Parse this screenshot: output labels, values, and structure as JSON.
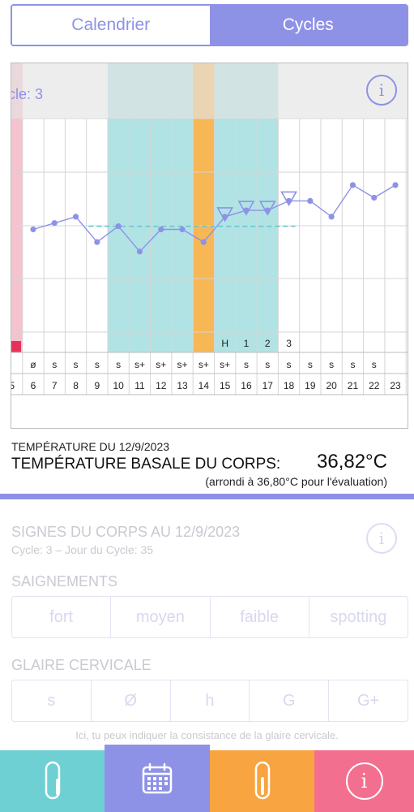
{
  "tabs": {
    "calendar": "Calendrier",
    "cycles": "Cycles"
  },
  "chart": {
    "cycle_label": "cle: 3",
    "info_glyph": "i",
    "day_numbers": [
      "5",
      "6",
      "7",
      "8",
      "9",
      "10",
      "11",
      "12",
      "13",
      "14",
      "15",
      "16",
      "17",
      "18",
      "19",
      "20",
      "21",
      "22",
      "23"
    ],
    "mucus_codes": [
      "",
      "ø",
      "s",
      "s",
      "s",
      "s",
      "s+",
      "s+",
      "s+",
      "s+",
      "s+",
      "s",
      "s",
      "s",
      "s",
      "s",
      "s",
      "s",
      ""
    ],
    "marker_codes": [
      "",
      "",
      "",
      "",
      "",
      "",
      "",
      "",
      "",
      "",
      "H",
      "1",
      "2",
      "3",
      "",
      "",
      "",
      "",
      ""
    ],
    "temperatures": [
      null,
      36.6,
      36.62,
      36.64,
      36.56,
      36.61,
      36.53,
      36.6,
      36.6,
      36.56,
      36.64,
      36.66,
      36.66,
      36.69,
      36.69,
      36.64,
      36.74,
      36.7,
      36.74
    ],
    "coverline": 36.61,
    "y_range": [
      36.35,
      36.95
    ],
    "colors": {
      "accent": "#8e92e6",
      "fertile": "#b1e3e4",
      "ovulation": "#f7b754",
      "period": "#f5c2cf",
      "period_dark": "#e8315a",
      "coverline": "#5fc6d0",
      "header_gray": "#e3e3e3"
    }
  },
  "temperature": {
    "date_line": "TEMPÉRATURE DU 12/9/2023",
    "label": "TEMPÉRATURE BASALE DU CORPS:",
    "value": "36,82°C",
    "rounded": "(arrondi à 36,80°C pour l'évaluation)"
  },
  "signs": {
    "title": "SIGNES DU CORPS AU 12/9/2023",
    "subtitle": "Cycle: 3 – Jour du Cycle: 35",
    "info_glyph": "i",
    "bleeding_label": "SAIGNEMENTS",
    "bleeding_options": [
      "fort",
      "moyen",
      "faible",
      "spotting"
    ],
    "mucus_label": "GLAIRE CERVICALE",
    "mucus_options": [
      "s",
      "Ø",
      "h",
      "G",
      "G+"
    ],
    "hint": "Ici, tu peux indiquer la consistance de la glaire cervicale."
  },
  "nav": {
    "items": [
      {
        "name": "thermometer-icon",
        "color": "#6fd0d3"
      },
      {
        "name": "calendar-icon",
        "color": "#8e92e6"
      },
      {
        "name": "temperature-icon",
        "color": "#f7a441"
      },
      {
        "name": "info-icon",
        "color": "#f36f8f",
        "glyph": "i"
      }
    ]
  }
}
